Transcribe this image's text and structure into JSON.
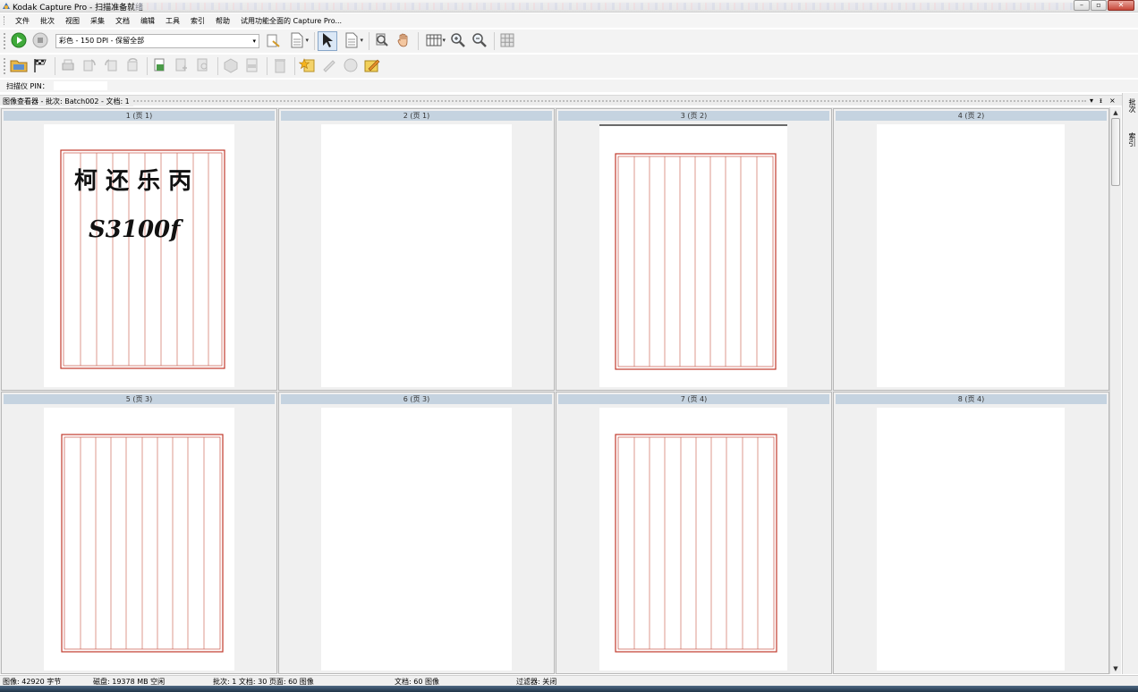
{
  "window": {
    "title": "Kodak Capture Pro - 扫描准备就绪"
  },
  "menu": [
    "文件",
    "批次",
    "视图",
    "采集",
    "文档",
    "编辑",
    "工具",
    "索引",
    "帮助",
    "试用功能全面的 Capture Pro..."
  ],
  "toolbar": {
    "profile": "彩色 - 150 DPI - 保留全部"
  },
  "pin": {
    "label": "扫描仪 PIN："
  },
  "viewer": {
    "title": "图像查看器 - 批次: Batch002 - 文档: 1",
    "pin_icon": "ᵻ",
    "close_icon": "×",
    "menu_icon": "▾"
  },
  "right_tabs": [
    "批次",
    "索引"
  ],
  "pages": [
    {
      "label": "1 (页 1)",
      "kind": "grid-handwritten",
      "handwriting_line1": "柯 还 乐 丙",
      "handwriting_line2": "S3100f"
    },
    {
      "label": "2 (页 1)",
      "kind": "blank"
    },
    {
      "label": "3 (页 2)",
      "kind": "grid"
    },
    {
      "label": "4 (页 2)",
      "kind": "blank"
    },
    {
      "label": "5 (页 3)",
      "kind": "grid"
    },
    {
      "label": "6 (页 3)",
      "kind": "blank"
    },
    {
      "label": "7 (页 4)",
      "kind": "grid"
    },
    {
      "label": "8 (页 4)",
      "kind": "blank"
    }
  ],
  "status": {
    "image": "图像: 42920 字节",
    "disk": "磁盘: 19378 MB 空闲",
    "batch": "批次: 1 文档: 30 页面: 60 图像",
    "doc": "文档: 60 图像",
    "filter": "过滤器: 关闭"
  },
  "colors": {
    "grid_line": "#c0392b",
    "thumb_label_bg": "#c5d3e0"
  }
}
